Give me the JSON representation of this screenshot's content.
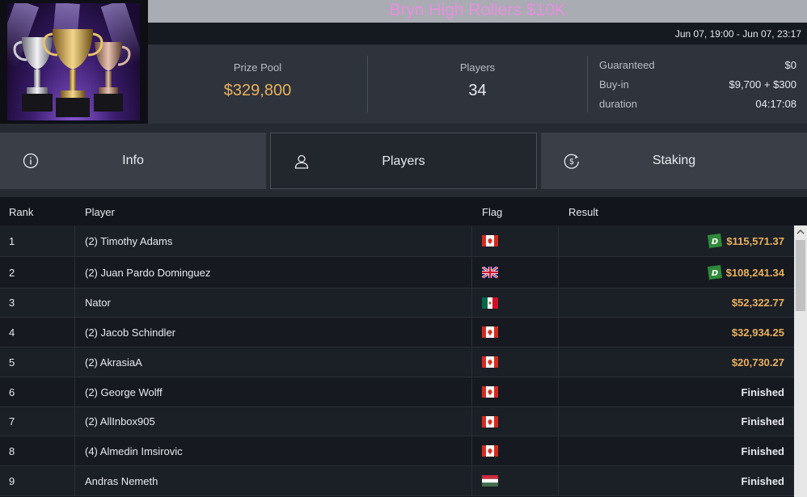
{
  "header": {
    "title": "Bryn High Rollers $10K",
    "date_range": "Jun 07, 19:00 - Jun 07, 23:17",
    "logo_icon": "trophy-cups-icon"
  },
  "stats": {
    "prize_pool_label": "Prize Pool",
    "prize_pool_value": "$329,800",
    "players_label": "Players",
    "players_value": "34"
  },
  "details": [
    {
      "label": "Guaranteed",
      "value": "$0"
    },
    {
      "label": "Buy-in",
      "value": "$9,700 + $300"
    },
    {
      "label": "duration",
      "value": "04:17:08"
    }
  ],
  "tabs": [
    {
      "label": "Info",
      "icon": "info-icon",
      "active": false
    },
    {
      "label": "Players",
      "icon": "user-icon",
      "active": true
    },
    {
      "label": "Staking",
      "icon": "dollar-coin-icon",
      "active": false
    }
  ],
  "table": {
    "columns": [
      "Rank",
      "Player",
      "Flag",
      "Result"
    ],
    "rows": [
      {
        "rank": "1",
        "player": "(2) Timothy Adams",
        "flag": "canada",
        "result": "$115,571.37",
        "paid": true,
        "badge": "D"
      },
      {
        "rank": "2",
        "player": "(2) Juan Pardo Dominguez",
        "flag": "uk",
        "result": "$108,241.34",
        "paid": true,
        "badge": "D"
      },
      {
        "rank": "3",
        "player": "Nator",
        "flag": "mexico",
        "result": "$52,322.77",
        "paid": true,
        "badge": ""
      },
      {
        "rank": "4",
        "player": "(2) Jacob Schindler",
        "flag": "canada",
        "result": "$32,934.25",
        "paid": true,
        "badge": ""
      },
      {
        "rank": "5",
        "player": "(2) AkrasiaA",
        "flag": "canada",
        "result": "$20,730.27",
        "paid": true,
        "badge": ""
      },
      {
        "rank": "6",
        "player": "(2) George Wolff",
        "flag": "canada",
        "result": "Finished",
        "paid": false,
        "badge": ""
      },
      {
        "rank": "7",
        "player": "(2) AllInbox905",
        "flag": "canada",
        "result": "Finished",
        "paid": false,
        "badge": ""
      },
      {
        "rank": "8",
        "player": "(4) Almedin Imsirovic",
        "flag": "canada",
        "result": "Finished",
        "paid": false,
        "badge": ""
      },
      {
        "rank": "9",
        "player": "Andras Nemeth",
        "flag": "hungary",
        "result": "Finished",
        "paid": false,
        "badge": ""
      }
    ]
  },
  "colors": {
    "title": "#e78fe0",
    "money": "#e9b15d",
    "badge": "#2f8a3a"
  }
}
